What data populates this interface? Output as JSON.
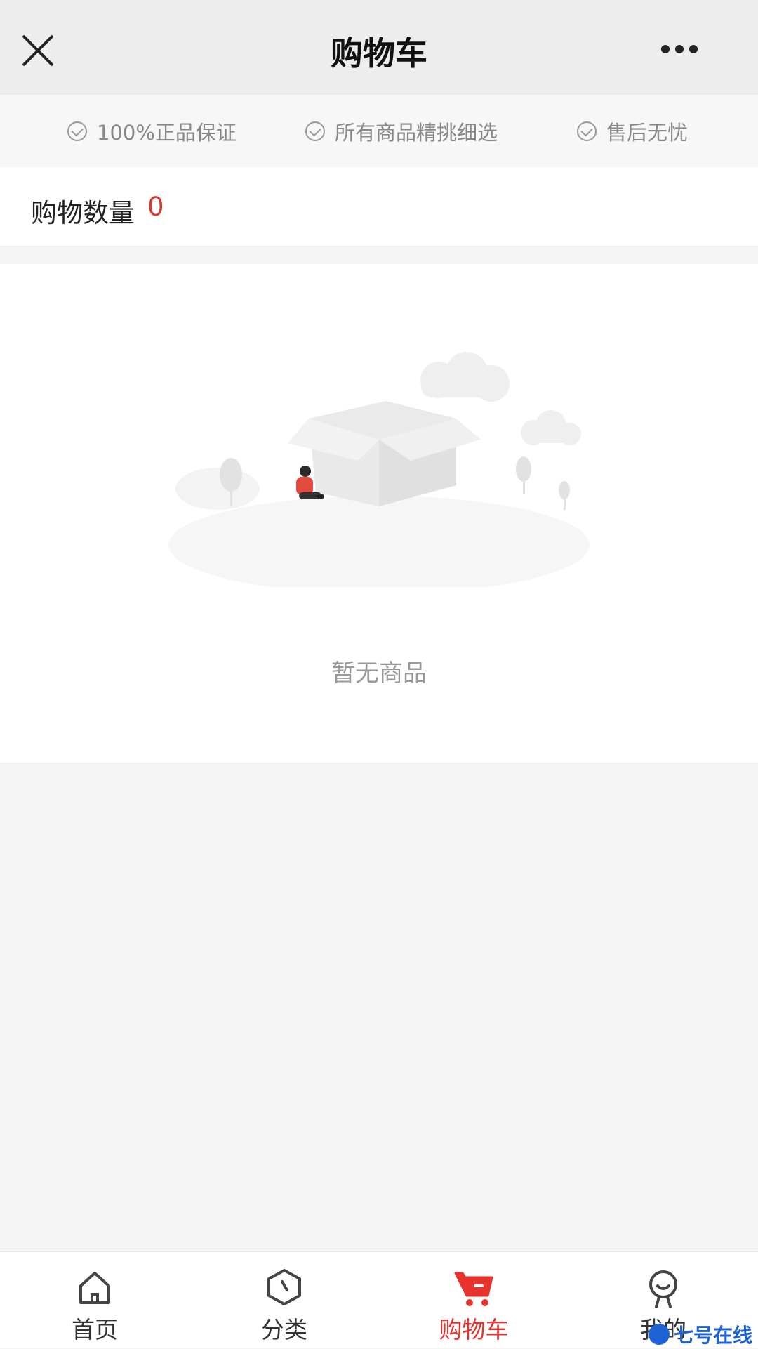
{
  "header": {
    "title": "购物车"
  },
  "guarantees": [
    {
      "label": "100%正品保证"
    },
    {
      "label": "所有商品精挑细选"
    },
    {
      "label": "售后无忧"
    }
  ],
  "cart": {
    "count_label": "购物数量",
    "count_value": "0"
  },
  "empty_state": {
    "message": "暂无商品"
  },
  "tabbar": {
    "tabs": [
      {
        "label": "首页",
        "icon": "home-icon"
      },
      {
        "label": "分类",
        "icon": "category-icon"
      },
      {
        "label": "购物车",
        "icon": "cart-icon",
        "active": true
      },
      {
        "label": "我的",
        "icon": "profile-icon"
      }
    ]
  },
  "watermark": {
    "text": "七号在线"
  },
  "colors": {
    "accent": "#e8322e",
    "count_color": "#d43c33",
    "header_bg": "#ededed"
  }
}
